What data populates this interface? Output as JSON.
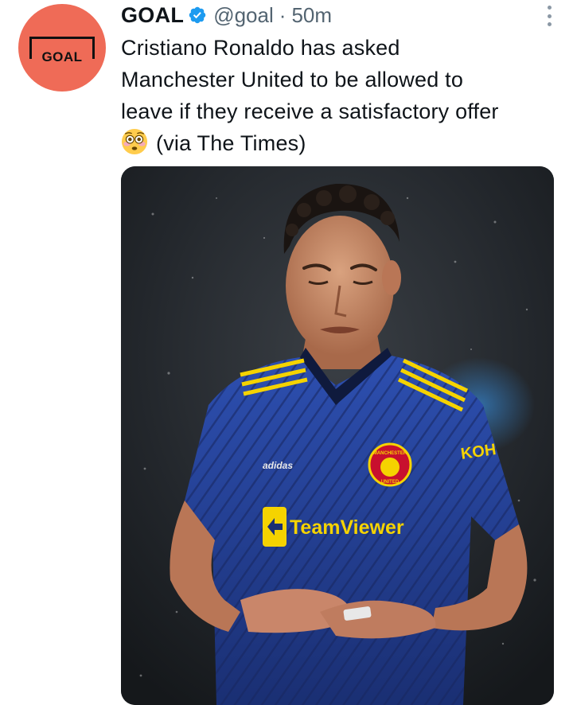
{
  "tweet": {
    "author_name": "GOAL",
    "handle": "@goal",
    "separator": "·",
    "time": "50m",
    "text_line1": "Cristiano Ronaldo has asked",
    "text_line2": "Manchester United to be allowed to",
    "text_line3": "leave if they receive a satisfactory offer",
    "text_line4": "(via The Times)",
    "emoji": "flushed-face-emoji"
  },
  "avatar": {
    "logo_text": "GOAL",
    "background": "#ef6b57"
  },
  "media": {
    "kit_brand": "adidas",
    "sponsor": "TeamViewer",
    "sleeve_sponsor": "KOH",
    "badge_text_top": "MANCHESTER",
    "badge_text_bottom": "UNITED"
  },
  "colors": {
    "verified": "#1d9bf0",
    "text": "#0f1419",
    "muted": "#536471"
  }
}
